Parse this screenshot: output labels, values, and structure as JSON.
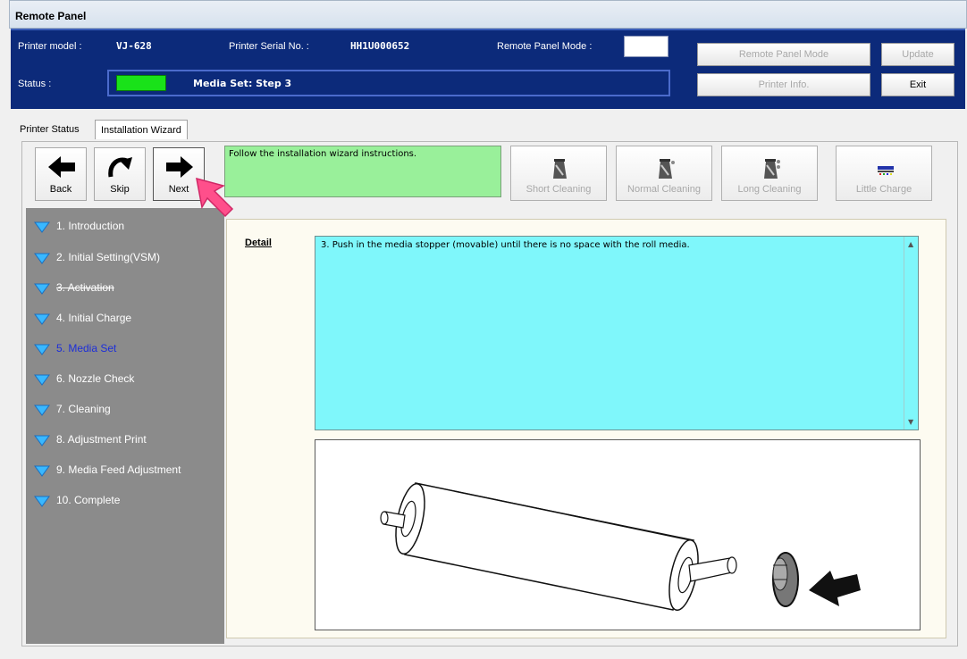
{
  "window": {
    "title": "Remote Panel"
  },
  "header": {
    "printer_model_label": "Printer model :",
    "printer_model_value": "VJ-628",
    "serial_label": "Printer Serial No. :",
    "serial_value": "HH1U000652",
    "mode_label": "Remote Panel Mode :",
    "status_label": "Status :",
    "status_color": "#19e219",
    "status_text": "Media Set: Step 3",
    "buttons": {
      "remote_panel_mode": "Remote Panel Mode",
      "update": "Update",
      "printer_info": "Printer Info.",
      "exit": "Exit"
    }
  },
  "tabs": [
    {
      "label": "Printer Status"
    },
    {
      "label": "Installation Wizard",
      "active": true
    }
  ],
  "toolbar": {
    "back": "Back",
    "skip": "Skip",
    "next": "Next",
    "instruction": "Follow the installation wizard instructions.",
    "cleaning_buttons": [
      {
        "label": "Short Cleaning",
        "icon": "short-cleaning-icon"
      },
      {
        "label": "Normal Cleaning",
        "icon": "normal-cleaning-icon"
      },
      {
        "label": "Long Cleaning",
        "icon": "long-cleaning-icon"
      },
      {
        "label": "Little Charge",
        "icon": "little-charge-icon"
      }
    ]
  },
  "steps": [
    {
      "label": "1. Introduction"
    },
    {
      "label": "2. Initial Setting(VSM)"
    },
    {
      "label": "3. Activation",
      "struck": true
    },
    {
      "label": "4. Initial Charge"
    },
    {
      "label": "5. Media Set",
      "active": true
    },
    {
      "label": "6. Nozzle Check"
    },
    {
      "label": "7. Cleaning"
    },
    {
      "label": "8. Adjustment Print"
    },
    {
      "label": "9. Media Feed Adjustment"
    },
    {
      "label": "10. Complete"
    }
  ],
  "detail": {
    "label": "Detail",
    "text": "3. Push in the media stopper (movable) until there is no space with the roll media."
  },
  "colors": {
    "header_bg": "#0c2a7a",
    "instruction_bg": "#99f09a",
    "detail_bg": "#7ff7fb",
    "steps_bg": "#8b8b8b",
    "active_step": "#1d2fd9",
    "cursor": "#ff4f8b"
  }
}
